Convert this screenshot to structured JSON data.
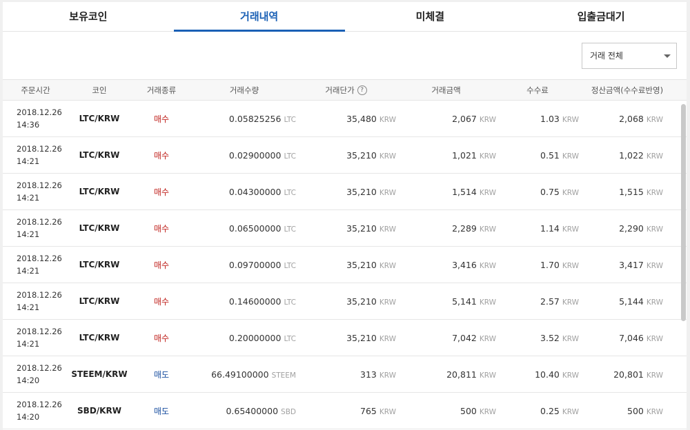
{
  "tabs": [
    {
      "label": "보유코인"
    },
    {
      "label": "거래내역"
    },
    {
      "label": "미체결"
    },
    {
      "label": "입출금대기"
    }
  ],
  "filter": {
    "selected": "거래 전체"
  },
  "columns": {
    "time": "주문시간",
    "coin": "코인",
    "type": "거래종류",
    "qty": "거래수량",
    "price": "거래단가",
    "amount": "거래금액",
    "fee": "수수료",
    "settle": "정산금액(수수료반영)"
  },
  "rows": [
    {
      "date": "2018.12.26",
      "time": "14:36",
      "coin": "LTC/KRW",
      "type": "매수",
      "qty": "0.05825256",
      "qty_unit": "LTC",
      "price": "35,480",
      "price_unit": "KRW",
      "amount": "2,067",
      "amount_unit": "KRW",
      "fee": "1.03",
      "fee_unit": "KRW",
      "settle": "2,068",
      "settle_unit": "KRW"
    },
    {
      "date": "2018.12.26",
      "time": "14:21",
      "coin": "LTC/KRW",
      "type": "매수",
      "qty": "0.02900000",
      "qty_unit": "LTC",
      "price": "35,210",
      "price_unit": "KRW",
      "amount": "1,021",
      "amount_unit": "KRW",
      "fee": "0.51",
      "fee_unit": "KRW",
      "settle": "1,022",
      "settle_unit": "KRW"
    },
    {
      "date": "2018.12.26",
      "time": "14:21",
      "coin": "LTC/KRW",
      "type": "매수",
      "qty": "0.04300000",
      "qty_unit": "LTC",
      "price": "35,210",
      "price_unit": "KRW",
      "amount": "1,514",
      "amount_unit": "KRW",
      "fee": "0.75",
      "fee_unit": "KRW",
      "settle": "1,515",
      "settle_unit": "KRW"
    },
    {
      "date": "2018.12.26",
      "time": "14:21",
      "coin": "LTC/KRW",
      "type": "매수",
      "qty": "0.06500000",
      "qty_unit": "LTC",
      "price": "35,210",
      "price_unit": "KRW",
      "amount": "2,289",
      "amount_unit": "KRW",
      "fee": "1.14",
      "fee_unit": "KRW",
      "settle": "2,290",
      "settle_unit": "KRW"
    },
    {
      "date": "2018.12.26",
      "time": "14:21",
      "coin": "LTC/KRW",
      "type": "매수",
      "qty": "0.09700000",
      "qty_unit": "LTC",
      "price": "35,210",
      "price_unit": "KRW",
      "amount": "3,416",
      "amount_unit": "KRW",
      "fee": "1.70",
      "fee_unit": "KRW",
      "settle": "3,417",
      "settle_unit": "KRW"
    },
    {
      "date": "2018.12.26",
      "time": "14:21",
      "coin": "LTC/KRW",
      "type": "매수",
      "qty": "0.14600000",
      "qty_unit": "LTC",
      "price": "35,210",
      "price_unit": "KRW",
      "amount": "5,141",
      "amount_unit": "KRW",
      "fee": "2.57",
      "fee_unit": "KRW",
      "settle": "5,144",
      "settle_unit": "KRW"
    },
    {
      "date": "2018.12.26",
      "time": "14:21",
      "coin": "LTC/KRW",
      "type": "매수",
      "qty": "0.20000000",
      "qty_unit": "LTC",
      "price": "35,210",
      "price_unit": "KRW",
      "amount": "7,042",
      "amount_unit": "KRW",
      "fee": "3.52",
      "fee_unit": "KRW",
      "settle": "7,046",
      "settle_unit": "KRW"
    },
    {
      "date": "2018.12.26",
      "time": "14:20",
      "coin": "STEEM/KRW",
      "type": "매도",
      "qty": "66.49100000",
      "qty_unit": "STEEM",
      "price": "313",
      "price_unit": "KRW",
      "amount": "20,811",
      "amount_unit": "KRW",
      "fee": "10.40",
      "fee_unit": "KRW",
      "settle": "20,801",
      "settle_unit": "KRW"
    },
    {
      "date": "2018.12.26",
      "time": "14:20",
      "coin": "SBD/KRW",
      "type": "매도",
      "qty": "0.65400000",
      "qty_unit": "SBD",
      "price": "765",
      "price_unit": "KRW",
      "amount": "500",
      "amount_unit": "KRW",
      "fee": "0.25",
      "fee_unit": "KRW",
      "settle": "500",
      "settle_unit": "KRW"
    }
  ],
  "colors": {
    "accent": "#1a60b5",
    "buy": "#c0241f",
    "sell": "#1a4fa0"
  },
  "icons": {
    "help": "question-circle-icon",
    "dropdown": "chevron-down-icon"
  }
}
